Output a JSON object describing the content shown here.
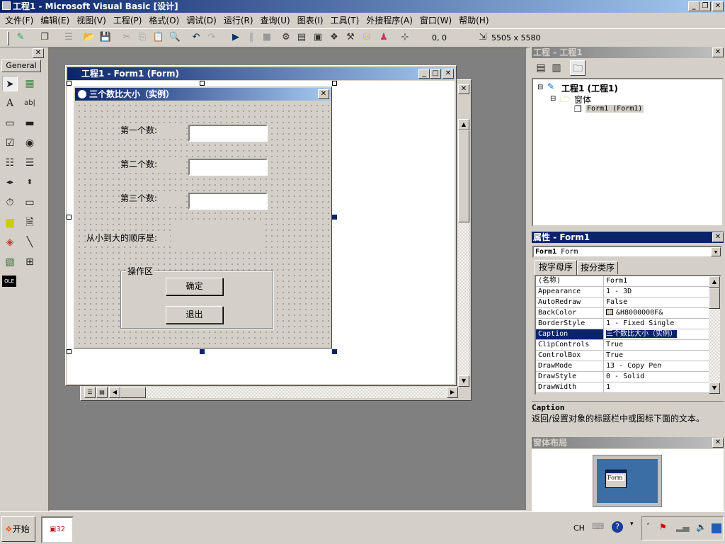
{
  "window": {
    "title": "工程1 - Microsoft Visual Basic [设计]",
    "min": "_",
    "restore": "❐",
    "close": "✕"
  },
  "menu": [
    "文件(F)",
    "编辑(E)",
    "视图(V)",
    "工程(P)",
    "格式(O)",
    "调试(D)",
    "运行(R)",
    "查询(U)",
    "图表(I)",
    "工具(T)",
    "外接程序(A)",
    "窗口(W)",
    "帮助(H)"
  ],
  "toolbar": {
    "position": "0, 0",
    "size": "5505 x 5580"
  },
  "toolbox": {
    "tab": "General",
    "close": "✕"
  },
  "designer": {
    "title": "工程1 - Form1 (Form)"
  },
  "form": {
    "caption": "三个数比大小（实例）",
    "close": "✕",
    "label1": "第一个数:",
    "label2": "第二个数:",
    "label3": "第三个数:",
    "order_label": "从小到大的顺序是:",
    "frame": "操作区",
    "ok": "确定",
    "exit": "退出"
  },
  "project": {
    "title": "工程 - 工程1",
    "root": "工程1 (工程1)",
    "folder": "窗体",
    "item": "Form1 (Form1)"
  },
  "properties": {
    "title": "属性 - Form1",
    "object_bold": "Form1",
    "object_type": "Form",
    "tabs": [
      "按字母序",
      "按分类序"
    ],
    "rows": [
      [
        "(名称)",
        "Form1"
      ],
      [
        "Appearance",
        "1 - 3D"
      ],
      [
        "AutoRedraw",
        "False"
      ],
      [
        "BackColor",
        "&H8000000F&"
      ],
      [
        "BorderStyle",
        "1 - Fixed Single"
      ],
      [
        "Caption",
        "三个数比大小（实例）"
      ],
      [
        "ClipControls",
        "True"
      ],
      [
        "ControlBox",
        "True"
      ],
      [
        "DrawMode",
        "13 - Copy Pen"
      ],
      [
        "DrawStyle",
        "0 - Solid"
      ],
      [
        "DrawWidth",
        "1"
      ]
    ],
    "desc_title": "Caption",
    "desc_text": "返回/设置对象的标题栏中或图标下面的文本。"
  },
  "layout": {
    "title": "窗体布局",
    "form_label": "Form"
  },
  "taskbar": {
    "start": "开始",
    "ime": "CH"
  },
  "colors": {
    "title_start": "#0a246a",
    "title_end": "#a6caf0",
    "face": "#d4d0c8",
    "workspace": "#808080",
    "monitor": "#3a6ea5"
  }
}
